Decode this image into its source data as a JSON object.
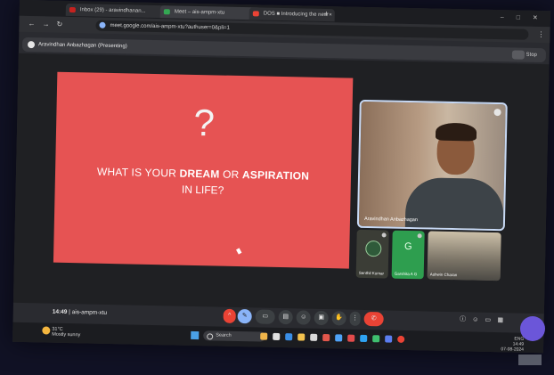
{
  "browser": {
    "tabs": [
      {
        "label": "Inbox (29) - aravindhanan...",
        "color": "#c5221f"
      },
      {
        "label": "Meet – ais-ampm-xtu",
        "color": "#34a853"
      },
      {
        "label": "DOS ■ Introducing the new",
        "color": "#ea4335"
      }
    ],
    "new_tab": "+",
    "window_controls": "– □ ✕",
    "back": "←",
    "forward": "→",
    "reload": "↻",
    "url": "meet.google.com/ais-ampm-xtu?authuser=0&pli=1",
    "menu": "⋮"
  },
  "presenting_bar": {
    "text": "Aravindhan Anbazhagan (Presenting)",
    "right_label": "Stop"
  },
  "slide": {
    "question_mark": "?",
    "line1_prefix": "WHAT IS YOUR ",
    "line1_bold1": "DREAM",
    "line1_mid": " OR ",
    "line1_bold2": "ASPIRATION",
    "line2": "IN LIFE?"
  },
  "participants": {
    "main_name": "Aravindhan Anbazhagan",
    "small": [
      {
        "name": "Senthil Kumar",
        "letter": ""
      },
      {
        "name": "Garshita A G",
        "letter": "G"
      },
      {
        "name": "Ashwin Charan",
        "letter": ""
      }
    ]
  },
  "controls": {
    "time": "14:49",
    "separator": "|",
    "meeting_code": "ais-ampm-xtu",
    "end_call": "✆"
  },
  "taskbar": {
    "temperature": "31°C",
    "weather_text": "Mostly sunny",
    "search_label": "Search",
    "tray_lang": "ENG",
    "tray_time": "14:49",
    "tray_date": "07-08-2024"
  },
  "colors": {
    "slide_bg": "#e65353",
    "end_call": "#ea4335",
    "active_tile_border": "#c7d9f5"
  }
}
